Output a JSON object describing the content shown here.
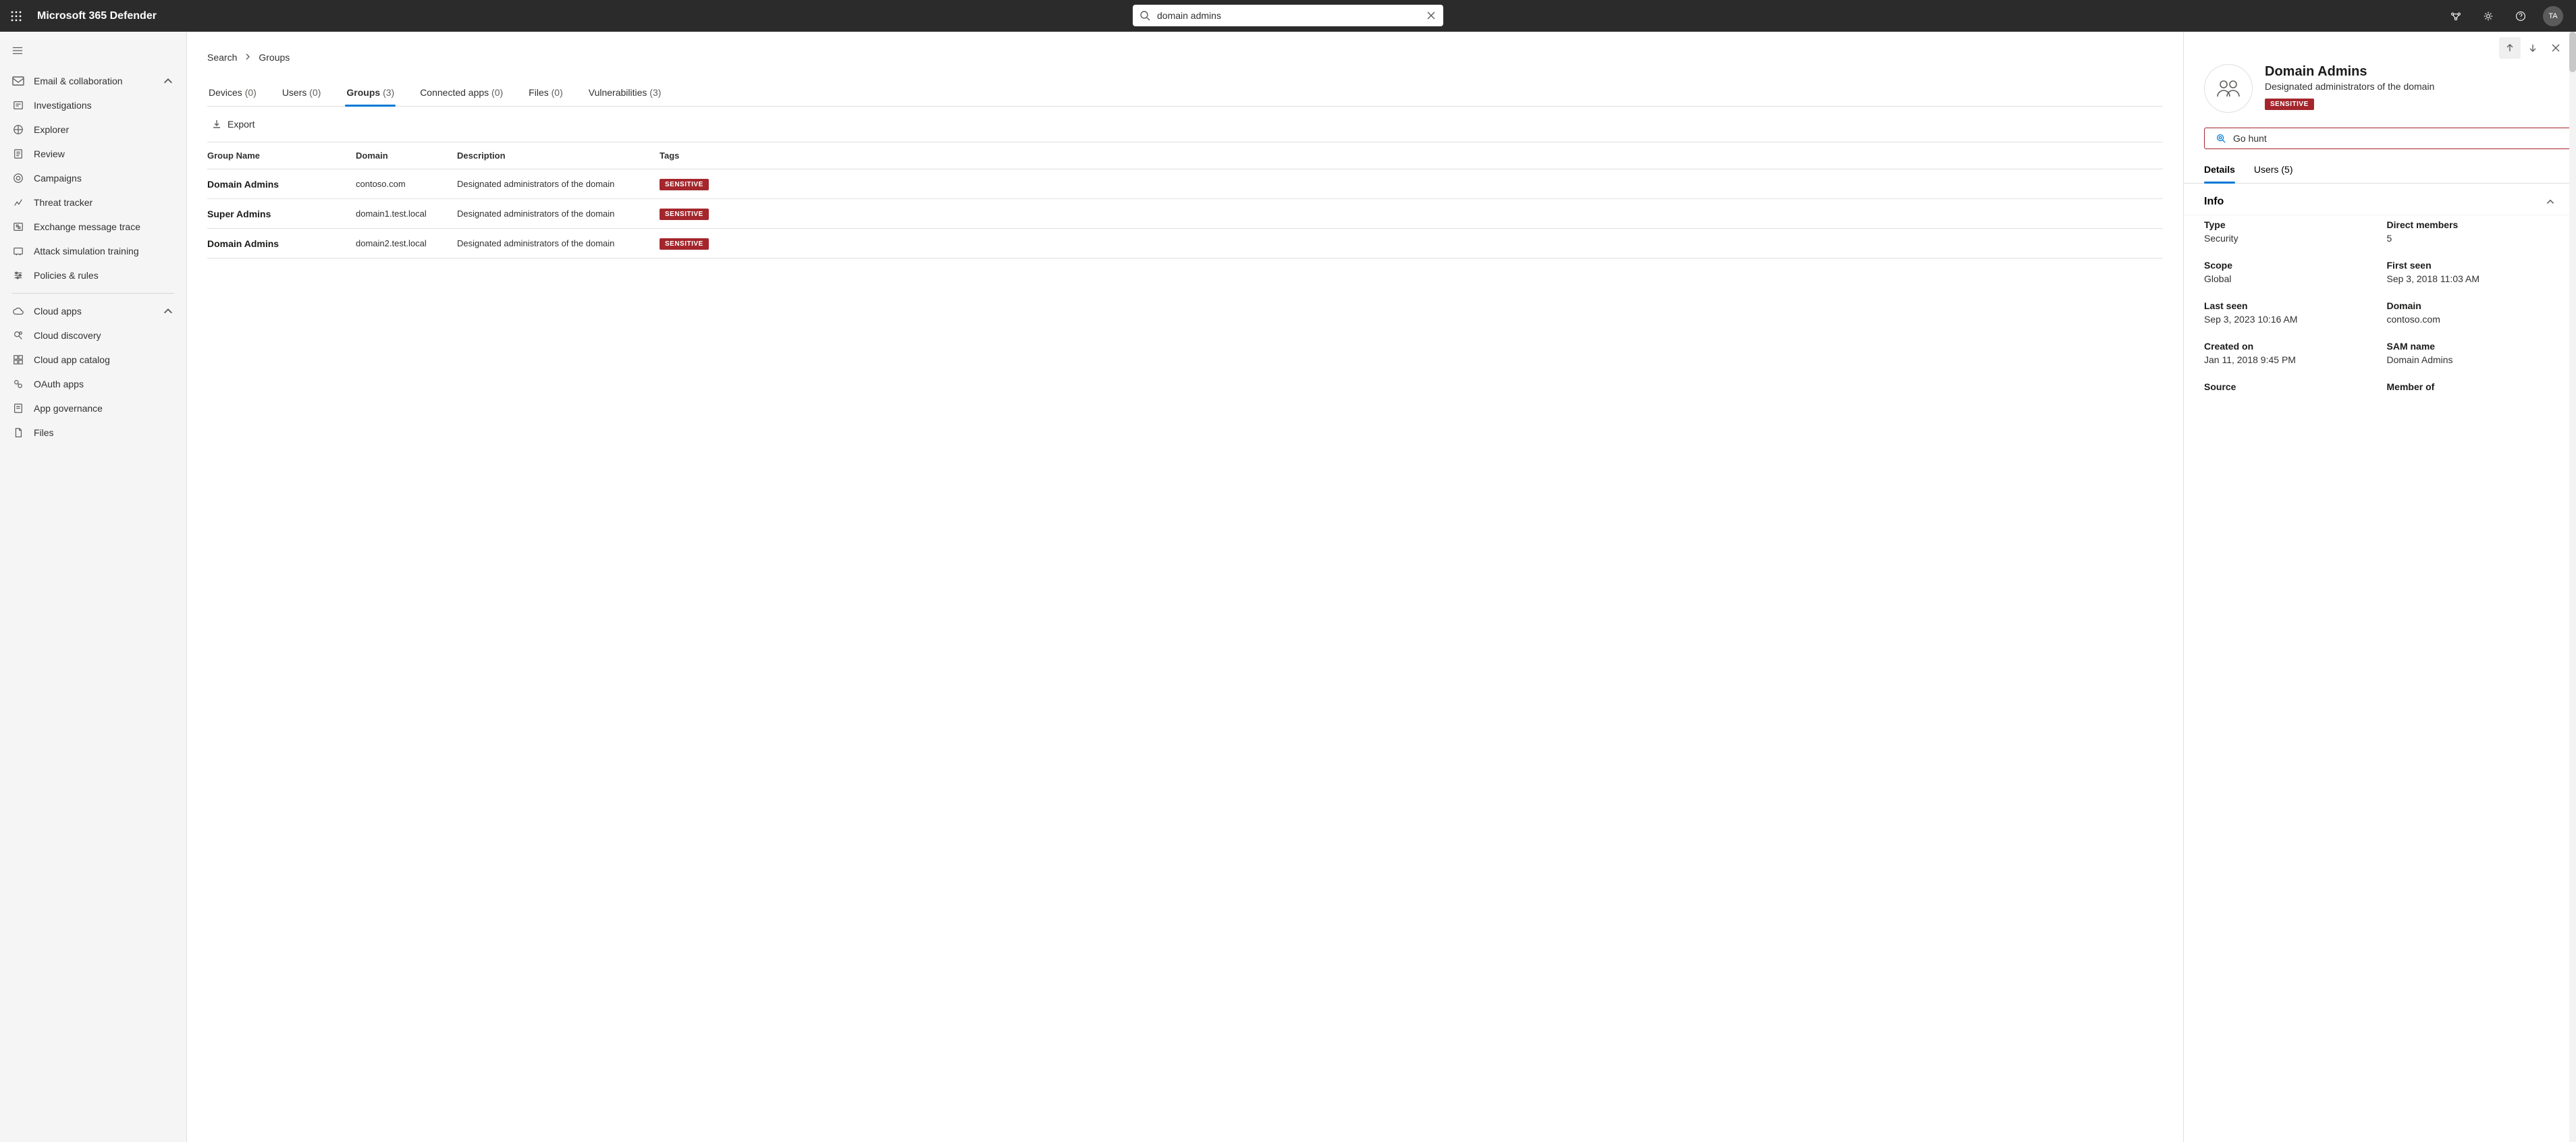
{
  "header": {
    "brand": "Microsoft 365 Defender",
    "search_value": "domain admins",
    "avatar_initials": "TA"
  },
  "nav": {
    "sections": [
      {
        "label": "Email & collaboration",
        "expandable": true
      },
      {
        "label": "Investigations"
      },
      {
        "label": "Explorer"
      },
      {
        "label": "Review"
      },
      {
        "label": "Campaigns"
      },
      {
        "label": "Threat tracker"
      },
      {
        "label": "Exchange message trace"
      },
      {
        "label": "Attack simulation training"
      },
      {
        "label": "Policies & rules"
      }
    ],
    "sections2": [
      {
        "label": "Cloud apps",
        "expandable": true
      },
      {
        "label": "Cloud discovery"
      },
      {
        "label": "Cloud app catalog"
      },
      {
        "label": "OAuth apps"
      },
      {
        "label": "App governance"
      },
      {
        "label": "Files"
      }
    ]
  },
  "breadcrumbs": {
    "root": "Search",
    "leaf": "Groups"
  },
  "tabs": {
    "devices": {
      "label": "Devices",
      "count": "(0)"
    },
    "users": {
      "label": "Users",
      "count": "(0)"
    },
    "groups": {
      "label": "Groups",
      "count": "(3)"
    },
    "apps": {
      "label": "Connected apps",
      "count": "(0)"
    },
    "files": {
      "label": "Files",
      "count": "(0)"
    },
    "vulns": {
      "label": "Vulnerabilities",
      "count": "(3)"
    }
  },
  "toolbar": {
    "export": "Export"
  },
  "columns": {
    "name": "Group Name",
    "domain": "Domain",
    "desc": "Description",
    "tags": "Tags"
  },
  "rows": [
    {
      "name": "Domain Admins",
      "domain": "contoso.com",
      "desc": "Designated administrators of the domain",
      "tag": "SENSITIVE"
    },
    {
      "name": "Super Admins",
      "domain": "domain1.test.local",
      "desc": "Designated administrators of the domain",
      "tag": "SENSITIVE"
    },
    {
      "name": "Domain Admins",
      "domain": "domain2.test.local",
      "desc": "Designated administrators of the domain",
      "tag": "SENSITIVE"
    }
  ],
  "panel": {
    "title": "Domain Admins",
    "subtitle": "Designated administrators of the domain",
    "badge": "SENSITIVE",
    "gohunt": "Go hunt",
    "tabs": {
      "details": "Details",
      "users": "Users (5)"
    },
    "info_header": "Info",
    "info": {
      "type_k": "Type",
      "type_v": "Security",
      "members_k": "Direct members",
      "members_v": "5",
      "scope_k": "Scope",
      "scope_v": "Global",
      "first_k": "First seen",
      "first_v": "Sep 3, 2018 11:03 AM",
      "last_k": "Last seen",
      "last_v": "Sep 3, 2023 10:16 AM",
      "domain_k": "Domain",
      "domain_v": "contoso.com",
      "created_k": "Created on",
      "created_v": "Jan 11, 2018 9:45 PM",
      "sam_k": "SAM name",
      "sam_v": "Domain Admins",
      "source_k": "Source",
      "member_k": "Member of"
    }
  }
}
